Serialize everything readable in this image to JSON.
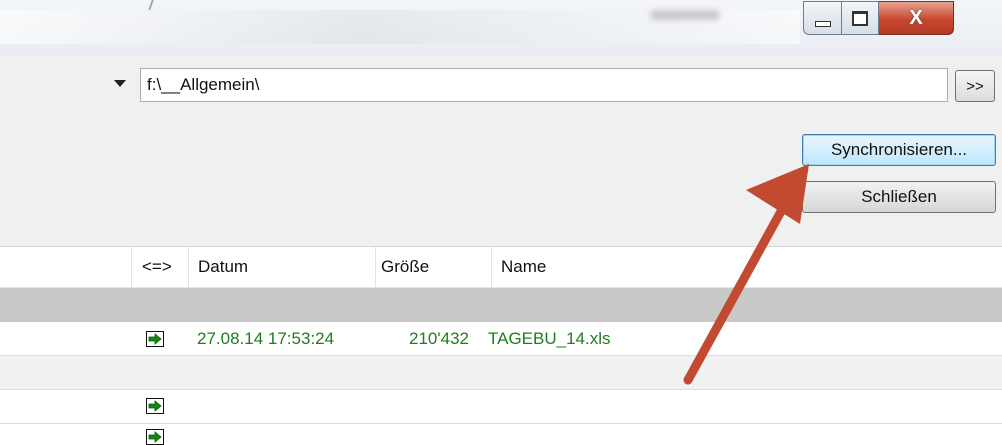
{
  "window": {
    "minimize_icon": "minimize-icon",
    "maximize_icon": "maximize-icon",
    "close_glyph": "X",
    "close_color": "#c8472f"
  },
  "toolbar": {
    "path_value": "f:\\__Allgemein\\",
    "more_label": ">>",
    "sync_label": "Synchronisieren...",
    "close_label": "Schließen"
  },
  "list": {
    "columns": [
      "<=>",
      "Datum",
      "Größe",
      "Name"
    ],
    "rows": [
      {
        "date": "27.08.14 17:53:24",
        "size": "210'432",
        "name": "TAGEBU_14.xls",
        "color": "#1f7d1f"
      }
    ]
  },
  "colors": {
    "accent_button": "#bee6fd",
    "annotation_arrow": "#c24a30",
    "row_text_green": "#1f7d1f",
    "group_row": "#c9c9c9"
  }
}
